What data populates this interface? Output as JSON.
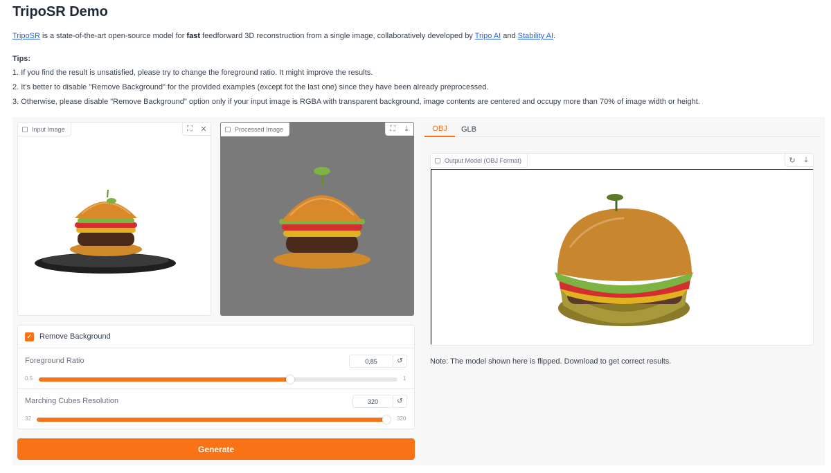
{
  "header": {
    "title": "TripoSR Demo",
    "intro": {
      "link_triposr": "TripoSR",
      "text_a": " is a state-of-the-art open-source model for ",
      "bold_fast": "fast",
      "text_b": " feedforward 3D reconstruction from a single image, collaboratively developed by ",
      "link_tripo_ai": "Tripo AI",
      "text_c": " and ",
      "link_stability_ai": "Stability AI",
      "text_d": "."
    },
    "tips_heading": "Tips:",
    "tips": [
      "1. If you find the result is unsatisfied, please try to change the foreground ratio. It might improve the results.",
      "2. It's better to disable \"Remove Background\" for the provided examples (except fot the last one) since they have been already preprocessed.",
      "3. Otherwise, please disable \"Remove Background\" option only if your input image is RGBA with transparent background, image contents are centered and occupy more than 70% of image width or height."
    ]
  },
  "input_image": {
    "label": "Input Image",
    "label_icon": "image-icon",
    "tools": [
      "fullscreen-icon",
      "close-icon"
    ]
  },
  "processed_image": {
    "label": "Processed Image",
    "label_icon": "image-icon",
    "tools": [
      "fullscreen-icon",
      "download-icon"
    ]
  },
  "controls": {
    "remove_background": {
      "label": "Remove Background",
      "checked": true
    },
    "foreground_ratio": {
      "label": "Foreground Ratio",
      "value": "0,85",
      "min": "0.5",
      "max": "1",
      "fraction": 0.7
    },
    "marching_cubes": {
      "label": "Marching Cubes Resolution",
      "value": "320",
      "min": "32",
      "max": "320",
      "fraction": 1.0
    }
  },
  "generate_button": {
    "label": "Generate"
  },
  "output": {
    "tabs": [
      {
        "label": "OBJ",
        "active": true
      },
      {
        "label": "GLB",
        "active": false
      }
    ],
    "model_label": "Output Model (OBJ Format)",
    "model_label_icon": "file-icon",
    "tools": [
      "undo-icon",
      "download-icon"
    ],
    "note": "Note: The model shown here is flipped. Download to get correct results."
  },
  "colors": {
    "accent": "#f97316",
    "link": "#2563eb",
    "processed_bg": "#7a7a7a"
  }
}
